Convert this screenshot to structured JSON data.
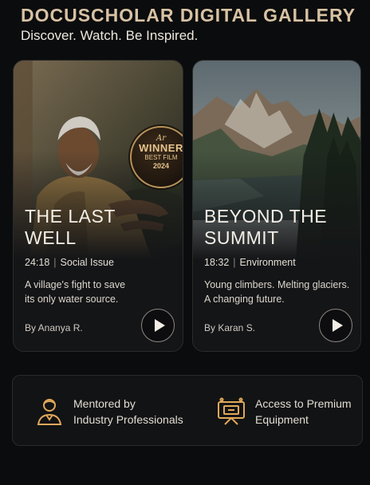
{
  "header": {
    "title": "DOCUSCHOLAR DIGITAL GALLERY",
    "tagline": "Discover. Watch. Be Inspired."
  },
  "cards": [
    {
      "title_line1": "THE LAST",
      "title_line2": "WELL",
      "duration": "24:18",
      "category": "Social Issue",
      "desc_line1": "A village's fight to save",
      "desc_line2": "its only water source.",
      "author": "By Ananya R.",
      "badge": {
        "script": "Ar",
        "main": "WINNER",
        "sub": "BEST FILM",
        "year": "2024"
      }
    },
    {
      "title_line1": "BEYOND THE",
      "title_line2": "SUMMIT",
      "duration": "18:32",
      "category": "Environment",
      "desc_line1": "Young climbers. Melting glaciers.",
      "desc_line2": "A changing future.",
      "author": "By Karan S."
    }
  ],
  "meta_separator": "|",
  "features": [
    {
      "line1": "Mentored by",
      "line2": "Industry Professionals",
      "icon": "mentor-icon"
    },
    {
      "line1": "Access to Premium",
      "line2": "Equipment",
      "icon": "equipment-icon"
    }
  ],
  "colors": {
    "accent": "#d8c2a3",
    "icon": "#e0a85a",
    "background": "#0b0c0d"
  }
}
